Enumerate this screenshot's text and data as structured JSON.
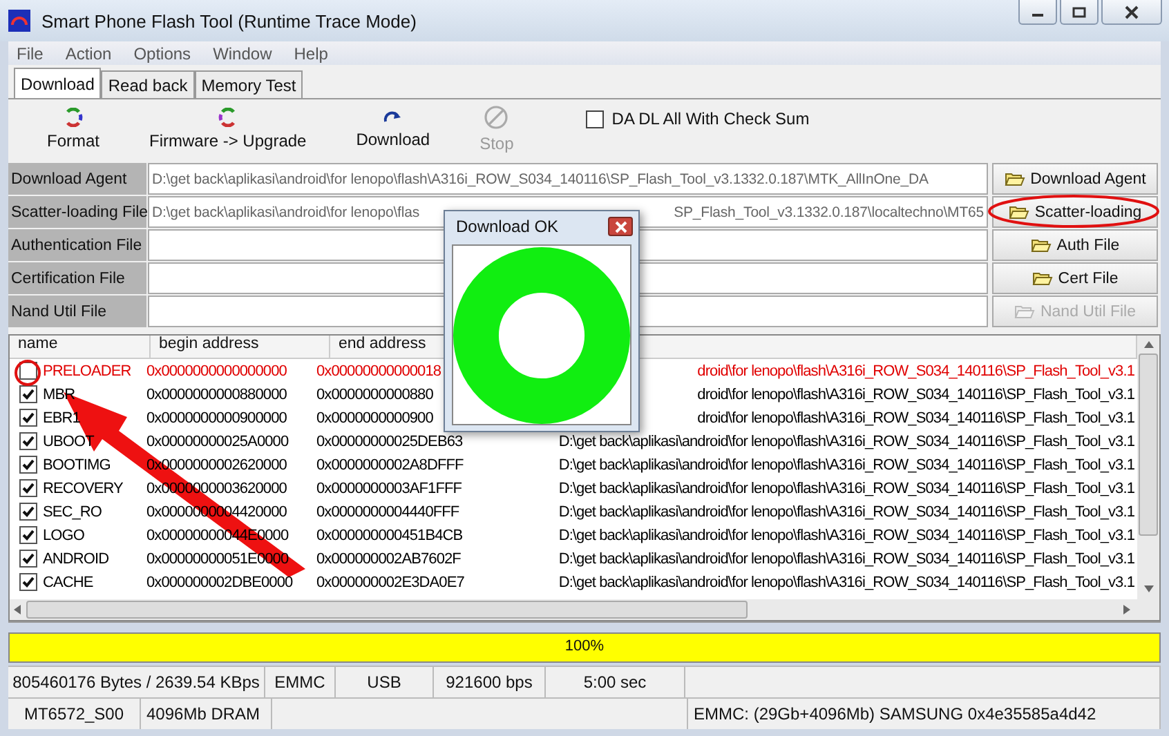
{
  "window": {
    "title": "Smart Phone Flash Tool (Runtime Trace Mode)"
  },
  "menu": [
    "File",
    "Action",
    "Options",
    "Window",
    "Help"
  ],
  "tabs": [
    {
      "label": "Download",
      "selected": true
    },
    {
      "label": "Read back",
      "selected": false
    },
    {
      "label": "Memory Test",
      "selected": false
    }
  ],
  "toolbar": [
    {
      "kind": "format",
      "label": "Format",
      "disabled": false
    },
    {
      "kind": "upgrade",
      "label": "Firmware -> Upgrade",
      "disabled": false
    },
    {
      "kind": "download",
      "label": "Download",
      "disabled": false
    },
    {
      "kind": "stop",
      "label": "Stop",
      "disabled": true
    }
  ],
  "checksum_option": {
    "label": "DA DL All With Check Sum",
    "checked": false
  },
  "files": [
    {
      "label": "Download Agent",
      "value": "D:\\get back\\aplikasi\\android\\for lenopo\\flash\\A316i_ROW_S034_140116\\SP_Flash_Tool_v3.1332.0.187\\MTK_AllInOne_DA",
      "button": "Download Agent",
      "disabled": false,
      "circled": false
    },
    {
      "label": "Scatter-loading File",
      "value": "D:\\get back\\aplikasi\\android\\for lenopo\\flas",
      "value_after_dialog": "SP_Flash_Tool_v3.1332.0.187\\localtechno\\MT65",
      "button": "Scatter-loading",
      "disabled": false,
      "circled": true
    },
    {
      "label": "Authentication File",
      "button": "Auth File",
      "disabled": false,
      "circled": false
    },
    {
      "label": "Certification File",
      "button": "Cert File",
      "disabled": false,
      "circled": false
    },
    {
      "label": "Nand Util File",
      "button": "Nand Util File",
      "disabled": true,
      "circled": false
    }
  ],
  "table": {
    "columns": [
      "name",
      "begin address",
      "end address"
    ],
    "rows": [
      {
        "name": "PRELOADER",
        "begin": "0x0000000000000000",
        "end": "0x00000000000018",
        "path": "droid\\for lenopo\\flash\\A316i_ROW_S034_140116\\SP_Flash_Tool_v3.1",
        "checked": false,
        "circled": true,
        "color": "#e00000"
      },
      {
        "name": "MBR",
        "begin": "0x0000000000880000",
        "end": "0x0000000000880",
        "path": "droid\\for lenopo\\flash\\A316i_ROW_S034_140116\\SP_Flash_Tool_v3.1",
        "checked": true,
        "circled": false,
        "color": "#000000"
      },
      {
        "name": "EBR1",
        "begin": "0x0000000000900000",
        "end": "0x0000000000900",
        "path": "droid\\for lenopo\\flash\\A316i_ROW_S034_140116\\SP_Flash_Tool_v3.1",
        "checked": true,
        "circled": false,
        "color": "#000000"
      },
      {
        "name": "UBOOT",
        "begin": "0x00000000025A0000",
        "end": "0x00000000025DEB63",
        "path": "D:\\get back\\aplikasi\\android\\for lenopo\\flash\\A316i_ROW_S034_140116\\SP_Flash_Tool_v3.1",
        "checked": true,
        "circled": false,
        "color": "#000000"
      },
      {
        "name": "BOOTIMG",
        "begin": "0x0000000002620000",
        "end": "0x0000000002A8DFFF",
        "path": "D:\\get back\\aplikasi\\android\\for lenopo\\flash\\A316i_ROW_S034_140116\\SP_Flash_Tool_v3.1",
        "checked": true,
        "circled": false,
        "color": "#000000"
      },
      {
        "name": "RECOVERY",
        "begin": "0x0000000003620000",
        "end": "0x0000000003AF1FFF",
        "path": "D:\\get back\\aplikasi\\android\\for lenopo\\flash\\A316i_ROW_S034_140116\\SP_Flash_Tool_v3.1",
        "checked": true,
        "circled": false,
        "color": "#000000"
      },
      {
        "name": "SEC_RO",
        "begin": "0x0000000004420000",
        "end": "0x0000000004440FFF",
        "path": "D:\\get back\\aplikasi\\android\\for lenopo\\flash\\A316i_ROW_S034_140116\\SP_Flash_Tool_v3.1",
        "checked": true,
        "circled": false,
        "color": "#000000"
      },
      {
        "name": "LOGO",
        "begin": "0x00000000044E0000",
        "end": "0x000000000451B4CB",
        "path": "D:\\get back\\aplikasi\\android\\for lenopo\\flash\\A316i_ROW_S034_140116\\SP_Flash_Tool_v3.1",
        "checked": true,
        "circled": false,
        "color": "#000000"
      },
      {
        "name": "ANDROID",
        "begin": "0x00000000051E0000",
        "end": "0x000000002AB7602F",
        "path": "D:\\get back\\aplikasi\\android\\for lenopo\\flash\\A316i_ROW_S034_140116\\SP_Flash_Tool_v3.1",
        "checked": true,
        "circled": false,
        "color": "#000000"
      },
      {
        "name": "CACHE",
        "begin": "0x000000002DBE0000",
        "end": "0x000000002E3DA0E7",
        "path": "D:\\get back\\aplikasi\\android\\for lenopo\\flash\\A316i_ROW_S034_140116\\SP_Flash_Tool_v3.1",
        "checked": true,
        "circled": false,
        "color": "#000000"
      }
    ]
  },
  "progress": {
    "level": 1,
    "reading": "100%"
  },
  "status_bar": {
    "row_1": [
      "805460176 Bytes / 2639.54 KBps",
      "EMMC",
      "USB",
      "921600 bps",
      "5:00 sec"
    ],
    "row_2": [
      "MT6572_S00",
      "4096Mb DRAM",
      "EMMC: (29Gb+4096Mb) SAMSUNG 0x4e35585a4d42"
    ]
  },
  "dialog": {
    "title": "Download OK"
  }
}
